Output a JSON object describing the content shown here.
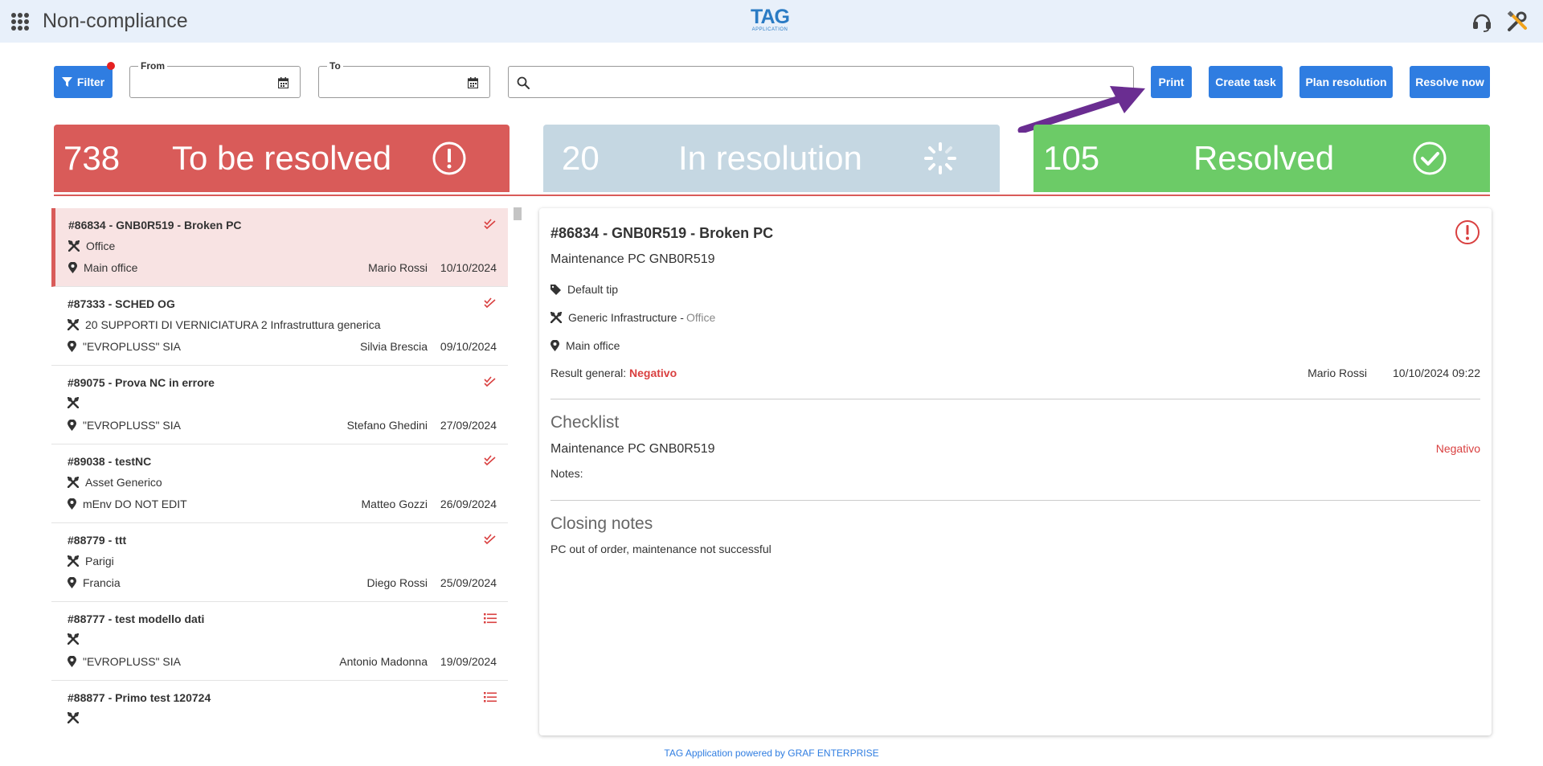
{
  "header": {
    "title": "Non-compliance",
    "logo_main": "TAG",
    "logo_sub": "APPLICATION"
  },
  "toolbar": {
    "filter_label": "Filter",
    "from_label": "From",
    "to_label": "To",
    "from_value": "",
    "to_value": "",
    "search_value": "",
    "print_label": "Print",
    "create_task_label": "Create task",
    "plan_resolution_label": "Plan resolution",
    "resolve_now_label": "Resolve now"
  },
  "stats": {
    "to_be_resolved": {
      "count": "738",
      "label": "To be resolved",
      "color": "#d95b59"
    },
    "in_resolution": {
      "count": "20",
      "label": "In resolution",
      "color": "#c5d7e2"
    },
    "resolved": {
      "count": "105",
      "label": "Resolved",
      "color": "#6ccb67"
    }
  },
  "list": [
    {
      "title": "#86834 - GNB0R519 - Broken PC",
      "asset": "Office",
      "location": "Main office",
      "user": "Mario Rossi",
      "date": "10/10/2024",
      "status": "double-check-icon"
    },
    {
      "title": "#87333 - SCHED OG",
      "asset": "20 SUPPORTI DI VERNICIATURA 2 Infrastruttura generica",
      "location": "\"EVROPLUSS\" SIA",
      "user": "Silvia Brescia",
      "date": "09/10/2024",
      "status": "double-check-icon"
    },
    {
      "title": "#89075 - Prova NC in errore",
      "asset": "",
      "location": "\"EVROPLUSS\" SIA",
      "user": "Stefano Ghedini",
      "date": "27/09/2024",
      "status": "double-check-icon"
    },
    {
      "title": "#89038 - testNC",
      "asset": "Asset Generico",
      "location": "mEnv DO NOT EDIT",
      "user": "Matteo Gozzi",
      "date": "26/09/2024",
      "status": "double-check-icon"
    },
    {
      "title": "#88779 - ttt",
      "asset": "Parigi",
      "location": "Francia",
      "user": "Diego Rossi",
      "date": "25/09/2024",
      "status": "double-check-icon"
    },
    {
      "title": "#88777 - test modello dati",
      "asset": "",
      "location": "\"EVROPLUSS\" SIA",
      "user": "Antonio Madonna",
      "date": "19/09/2024",
      "status": "list-icon"
    },
    {
      "title": "#88877 - Primo test 120724",
      "asset": "",
      "location": "",
      "user": "",
      "date": "",
      "status": "list-icon"
    }
  ],
  "detail": {
    "title": "#86834 - GNB0R519 - Broken PC",
    "subtitle": "Maintenance PC GNB0R519",
    "tag": "Default tip",
    "infrastructure": "Generic Infrastructure -",
    "infrastructure_sub": "Office",
    "location": "Main office",
    "result_label": "Result general:",
    "result_value": "Negativo",
    "user": "Mario Rossi",
    "datetime": "10/10/2024 09:22",
    "checklist_heading": "Checklist",
    "checklist_item": "Maintenance PC GNB0R519",
    "checklist_value": "Negativo",
    "notes_label": "Notes:",
    "closing_heading": "Closing notes",
    "closing_text": "PC out of order, maintenance not successful"
  },
  "footer": "TAG Application powered by GRAF ENTERPRISE"
}
